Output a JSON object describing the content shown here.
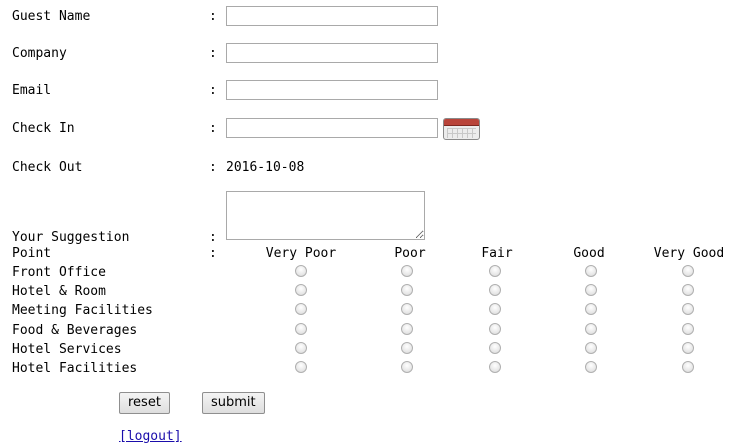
{
  "form": {
    "colon": ":",
    "fields": {
      "guest_name": {
        "label": "Guest Name",
        "value": ""
      },
      "company": {
        "label": "Company",
        "value": ""
      },
      "email": {
        "label": "Email",
        "value": ""
      },
      "check_in": {
        "label": "Check In",
        "value": ""
      },
      "check_out": {
        "label": "Check Out",
        "value": "2016-10-08"
      },
      "suggestion": {
        "label": "Your Suggestion",
        "value": ""
      }
    },
    "rating": {
      "label": "Point",
      "columns": [
        "Very Poor",
        "Poor",
        "Fair",
        "Good",
        "Very Good"
      ],
      "rows": [
        {
          "label": "Front Office",
          "selected": null
        },
        {
          "label": "Hotel & Room",
          "selected": null
        },
        {
          "label": "Meeting Facilities",
          "selected": null
        },
        {
          "label": "Food & Beverages",
          "selected": null
        },
        {
          "label": "Hotel Services",
          "selected": null
        },
        {
          "label": "Hotel Facilities",
          "selected": null
        }
      ]
    },
    "buttons": {
      "reset": "reset",
      "submit": "submit"
    },
    "logout": "[logout]"
  },
  "icons": {
    "check_in_picker": "calendar-icon"
  }
}
